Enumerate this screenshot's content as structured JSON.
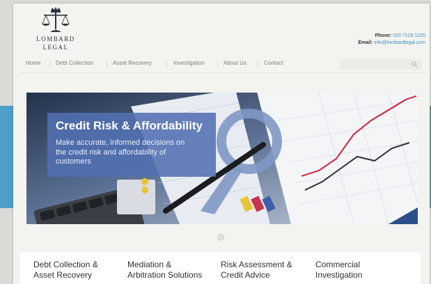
{
  "brand": {
    "name_line1": "LOMBARD",
    "name_line2": "LEGAL"
  },
  "contact": {
    "phone_label": "Phone:",
    "phone": "020 7129 1220",
    "email_label": "Email:",
    "email": "info@lombardlegal.com"
  },
  "nav": {
    "items": [
      "Home",
      "Debt Collection",
      "Asset Recovery",
      "Investigation",
      "About Us",
      "Contact"
    ],
    "search_placeholder": ""
  },
  "hero": {
    "title": "Credit Risk & Affordability",
    "text": "Make accurate, informed decisions on the credit risk and affordability of customers"
  },
  "services": [
    {
      "line1": "Debt Collection &",
      "line2": "Asset Recovery"
    },
    {
      "line1": "Mediation &",
      "line2": "Arbitration Solutions"
    },
    {
      "line1": "Risk Assessment &",
      "line2": "Credit Advice"
    },
    {
      "line1": "Commercial",
      "line2": "Investigation"
    }
  ],
  "colors": {
    "accent_blue": "#4f9ec9",
    "caption_blue": "#5270b2",
    "link": "#3f8fc2"
  },
  "icons": {
    "logo": "scales-of-justice-crown",
    "search": "magnifier"
  }
}
